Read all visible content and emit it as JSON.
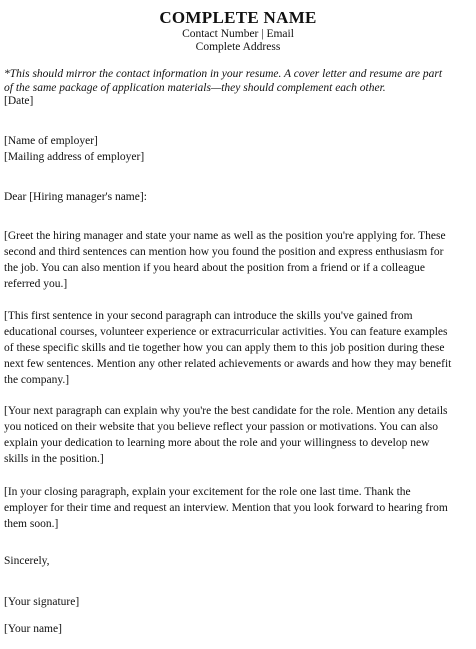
{
  "header": {
    "name": "COMPLETE NAME",
    "contact": "Contact Number | Email",
    "address": "Complete Address"
  },
  "note": {
    "lines": [
      "*This should mirror the contact information in your resume. A cover letter and resume are part",
      "of the same package of application materials—they should complement each other."
    ]
  },
  "date": "[Date]",
  "employer": {
    "name": "[Name of employer]",
    "address": "[Mailing address of employer]"
  },
  "salutation": "Dear [Hiring manager's name]:",
  "paragraphs": [
    [
      "[Greet the hiring manager and state your name as well as the position you're applying for. These",
      "second and third sentences can mention how you found the position and express enthusiasm for",
      "the job. You can also mention if you heard about the position from a friend or if a colleague",
      "referred you.]"
    ],
    [
      "[This first sentence in your second paragraph can introduce the skills you've gained from",
      "educational courses, volunteer experience or extracurricular activities. You can feature examples",
      "of these specific skills and tie together how you can apply them to this job position during these",
      "next few sentences. Mention any other related achievements or awards and how they may benefit",
      "the company.]"
    ],
    [
      "[Your next paragraph can explain why you're the best candidate for the role. Mention any details",
      "you noticed on their website that you believe reflect your passion or motivations. You can also",
      "explain your dedication to learning more about the role and your willingness to develop new",
      "skills in the position.]"
    ],
    [
      "[In your closing paragraph, explain your excitement for the role one last time. Thank the",
      "employer for their time and request an interview. Mention that you look forward to hearing from",
      "them soon.]"
    ]
  ],
  "closing": "Sincerely,",
  "signature": "[Your signature]",
  "your_name": "[Your name]"
}
